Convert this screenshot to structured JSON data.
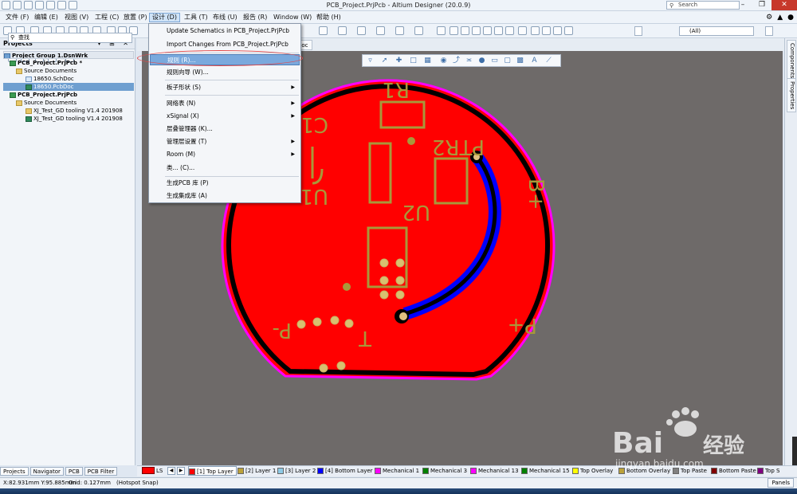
{
  "window": {
    "title": "PCB_Project.PrjPcb - Altium Designer (20.0.9)",
    "search_placeholder": "Search"
  },
  "menubar": {
    "items": [
      "文件 (F)",
      "编辑 (E)",
      "视图 (V)",
      "工程 (C)",
      "放置 (P)",
      "设计 (D)",
      "工具 (T)",
      "布线 (U)",
      "报告 (R)",
      "Window (W)",
      "帮助 (H)"
    ],
    "active_index": 5
  },
  "toolbar": {
    "filter_value": "(All)"
  },
  "projects_panel": {
    "title": "Projects",
    "search_placeholder": "查找",
    "tree": [
      {
        "label": "Project Group 1.DsnWrk",
        "level": 0,
        "icon": "group",
        "bold": true
      },
      {
        "label": "PCB_Project.PrjPcb *",
        "level": 1,
        "icon": "project",
        "bold": true
      },
      {
        "label": "Source Documents",
        "level": 2,
        "icon": "folder"
      },
      {
        "label": "18650.SchDoc",
        "level": 3,
        "icon": "schdoc"
      },
      {
        "label": "18650.PcbDoc",
        "level": 3,
        "icon": "pcbdoc",
        "selected": true
      },
      {
        "label": "PCB_Project.PrjPcb",
        "level": 1,
        "icon": "project",
        "bold": true
      },
      {
        "label": "Source Documents",
        "level": 2,
        "icon": "folder"
      },
      {
        "label": "XJ_Test_GD tooling V1.4 201908",
        "level": 3,
        "icon": "folder"
      },
      {
        "label": "XJ_Test_GD tooling V1.4 201908",
        "level": 3,
        "icon": "pcbdoc"
      }
    ]
  },
  "doc_tab": {
    "label": "Doc"
  },
  "design_menu": {
    "items": [
      {
        "label": "Update Schematics in PCB_Project.PrjPcb",
        "submenu": false
      },
      {
        "label": "Import Changes From PCB_Project.PrjPcb",
        "submenu": false
      },
      {
        "separator": true
      },
      {
        "label": "规则 (R)...",
        "submenu": false,
        "highlighted": true
      },
      {
        "label": "规则向导 (W)...",
        "submenu": false
      },
      {
        "separator": true
      },
      {
        "label": "板子形状 (S)",
        "submenu": true
      },
      {
        "separator": true
      },
      {
        "label": "网络表 (N)",
        "submenu": true
      },
      {
        "label": "xSignal (X)",
        "submenu": true
      },
      {
        "label": "层叠管理器 (K)...",
        "submenu": false
      },
      {
        "label": "管理层设置 (T)",
        "submenu": true
      },
      {
        "label": "Room (M)",
        "submenu": true
      },
      {
        "label": "类... (C)...",
        "submenu": false
      },
      {
        "separator": true
      },
      {
        "label": "生成PCB 库 (P)",
        "submenu": false
      },
      {
        "label": "生成集成库 (A)",
        "submenu": false
      }
    ]
  },
  "pcb": {
    "labels": [
      "R1",
      "C1",
      "U1",
      "U2",
      "PTR2",
      "B+",
      "P-",
      "P+",
      "T"
    ]
  },
  "layer_bar": {
    "ls_label": "LS",
    "layers": [
      {
        "name": "[1] Top Layer",
        "color": "#ff0000",
        "active": true
      },
      {
        "name": "[2] Layer 1",
        "color": "#bca23a"
      },
      {
        "name": "[3] Layer 2",
        "color": "#8ecae6"
      },
      {
        "name": "[4] Bottom Layer",
        "color": "#0000ff"
      },
      {
        "name": "Mechanical 1",
        "color": "#ff00ff"
      },
      {
        "name": "Mechanical 3",
        "color": "#008000"
      },
      {
        "name": "Mechanical 13",
        "color": "#ff00ff"
      },
      {
        "name": "Mechanical 15",
        "color": "#008000"
      },
      {
        "name": "Top Overlay",
        "color": "#ffff00"
      },
      {
        "name": "Bottom Overlay",
        "color": "#bca23a"
      },
      {
        "name": "Top Paste",
        "color": "#808080"
      },
      {
        "name": "Bottom Paste",
        "color": "#800000"
      },
      {
        "name": "Top S",
        "color": "#800080"
      }
    ]
  },
  "panel_tabs": [
    "Projects",
    "Navigator",
    "PCB",
    "PCB Filter"
  ],
  "right_tabs": [
    "Components",
    "Properties"
  ],
  "status": {
    "coords": "X:82.931mm Y:95.885mm",
    "grid": "Grid: 0.127mm",
    "snap": "(Hotspot Snap)",
    "panels_label": "Panels"
  },
  "watermark": {
    "brand": "Bai du 经验",
    "url": "jingyan.baidu.com"
  }
}
